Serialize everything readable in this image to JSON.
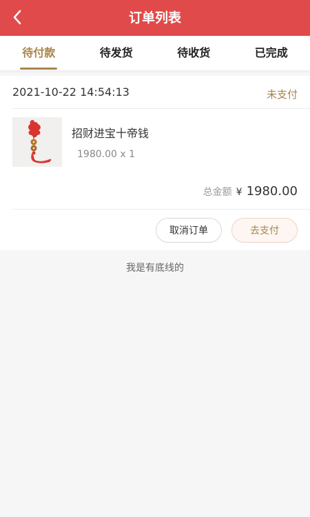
{
  "header": {
    "title": "订单列表",
    "back_icon": "chevron-left-icon"
  },
  "tabs": [
    {
      "label": "待付款",
      "active": true
    },
    {
      "label": "待发货",
      "active": false
    },
    {
      "label": "待收货",
      "active": false
    },
    {
      "label": "已完成",
      "active": false
    }
  ],
  "order": {
    "date": "2021-10-22 14:54:13",
    "status": "未支付",
    "product": {
      "name": "招财进宝十帝钱",
      "price_qty": "1980.00 x 1",
      "thumbnail": "red-chinese-knot-coin-tassel"
    },
    "total_label": "总金额",
    "currency": "¥",
    "total_amount": "1980.00",
    "buttons": {
      "cancel": "取消订单",
      "pay": "去支付"
    }
  },
  "footer_text": "我是有底线的",
  "colors": {
    "header_bg": "#e14a4a",
    "accent": "#a8844c",
    "page_bg": "#f6f6f6"
  }
}
